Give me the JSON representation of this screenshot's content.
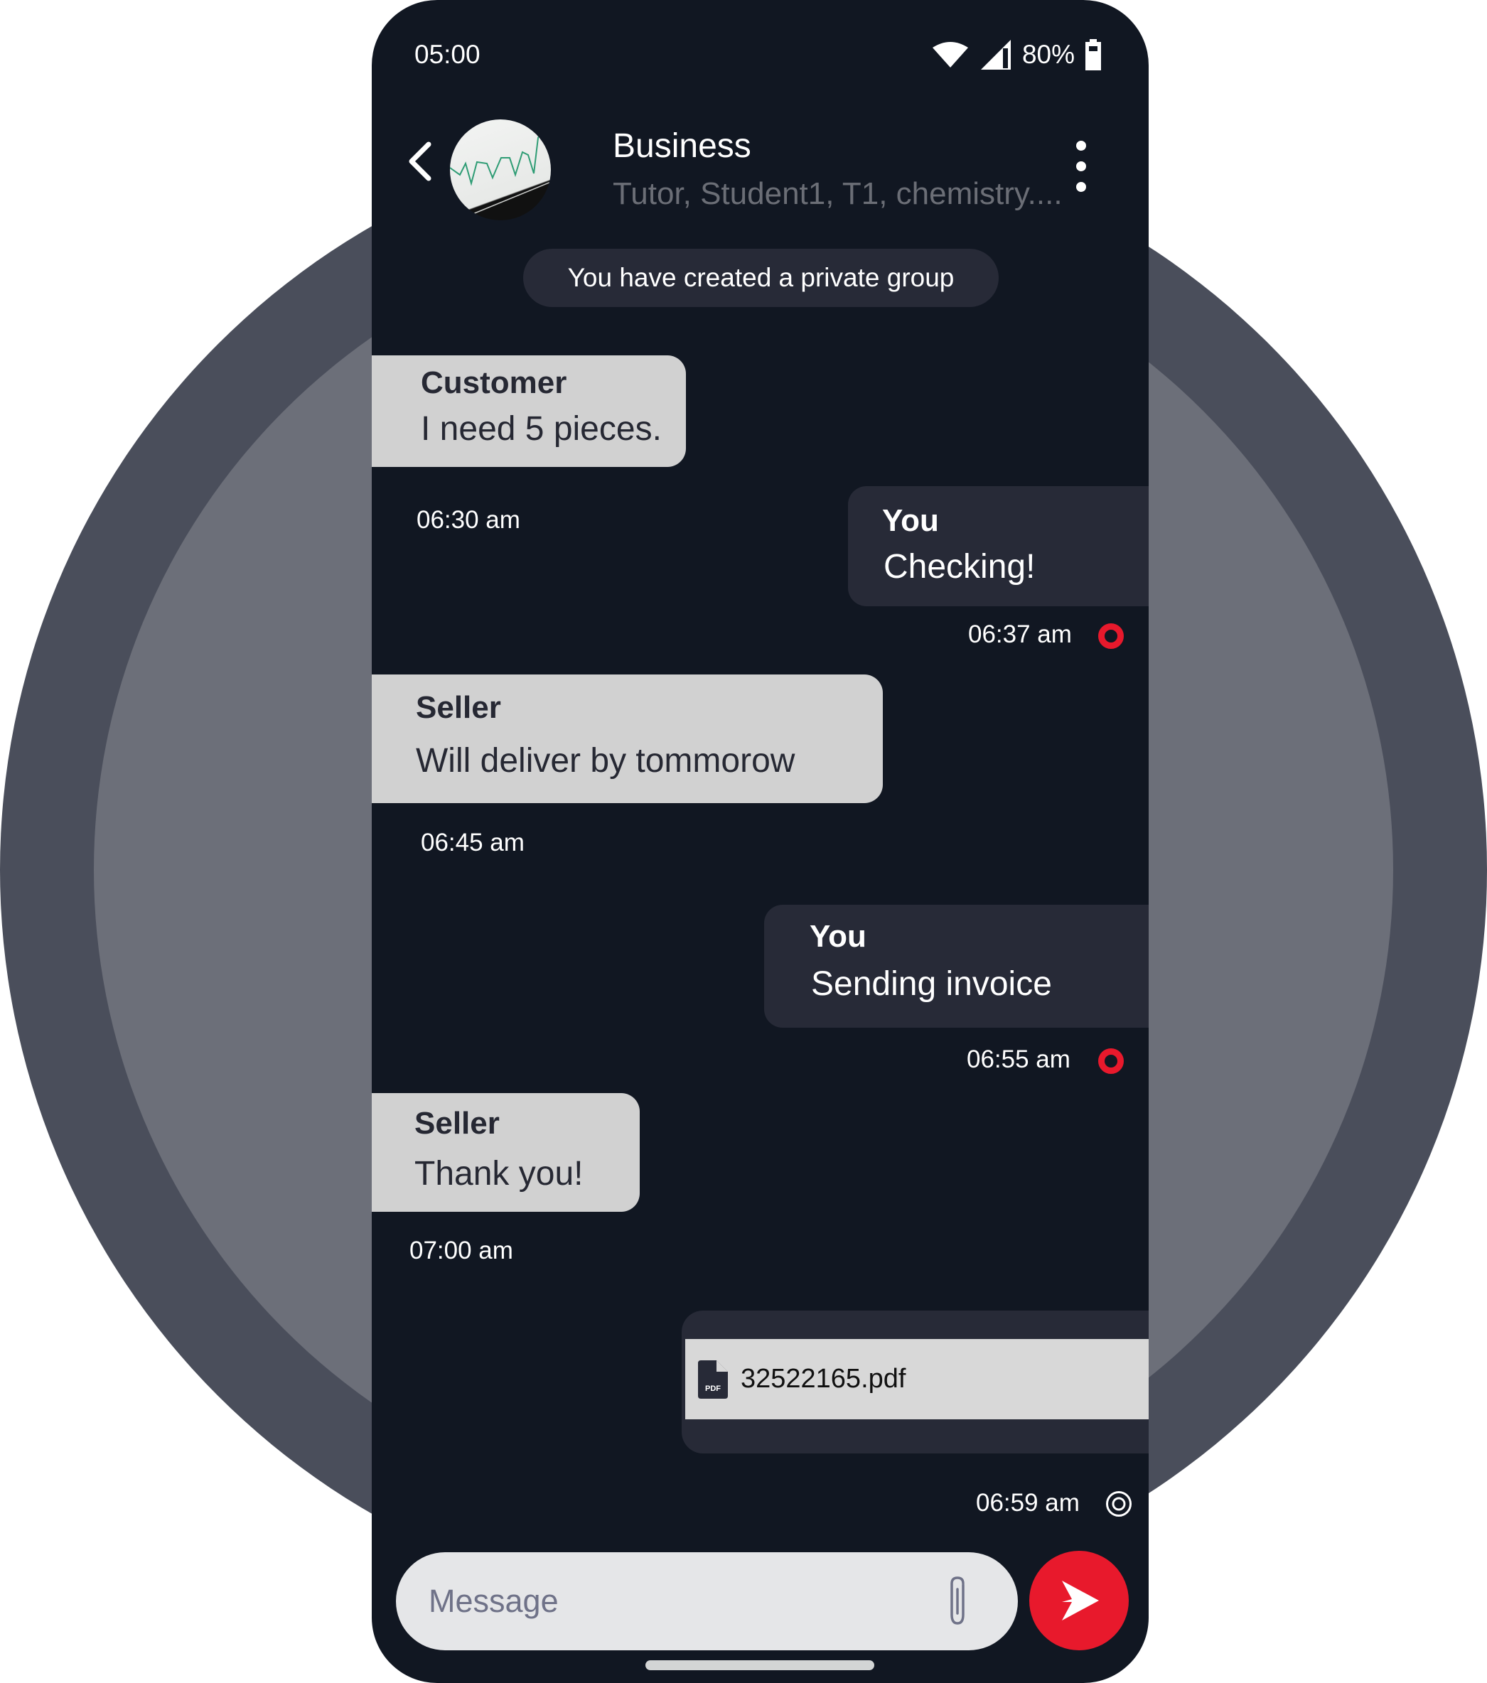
{
  "status_bar": {
    "time": "05:00",
    "battery": "80%",
    "icons": [
      "wifi-icon",
      "signal-icon",
      "battery-icon"
    ]
  },
  "header": {
    "back_icon": "chevron-left-icon",
    "avatar": "group-avatar-chart-image",
    "title": "Business",
    "subtitle": "Tutor, Student1, T1, chemistry....",
    "menu_icon": "kebab-menu-icon"
  },
  "system_message": "You have created a private group",
  "messages": [
    {
      "direction": "incoming",
      "sender": "Customer",
      "text": "I need 5 pieces.",
      "time": "06:30 am"
    },
    {
      "direction": "outgoing",
      "sender": "You",
      "text": "Checking!",
      "time": "06:37 am",
      "status_icon": "sent-ring-icon"
    },
    {
      "direction": "incoming",
      "sender": "Seller",
      "text": "Will  deliver by tommorow",
      "time": "06:45 am"
    },
    {
      "direction": "outgoing",
      "sender": "You",
      "text": "Sending invoice",
      "time": "06:55 am",
      "status_icon": "sent-ring-icon"
    },
    {
      "direction": "incoming",
      "sender": "Seller",
      "text": "Thank you!",
      "time": "07:00 am"
    },
    {
      "direction": "outgoing",
      "type": "file",
      "file_icon": "pdf-file-icon",
      "file_label": "PDF",
      "file_name": "32522165.pdf",
      "time": "06:59 am",
      "status_icon": "pending-ring-icon"
    }
  ],
  "composer": {
    "placeholder": "Message",
    "value": "",
    "attach_icon": "paperclip-icon",
    "send_icon": "send-arrow-icon"
  },
  "colors": {
    "phone_bg": "#111722",
    "outgoing_bubble": "#272a37",
    "incoming_bubble": "#d1d1d1",
    "accent": "#e8192c",
    "outer_circle": "#4a4e5b",
    "inner_circle": "#6c6f79"
  }
}
